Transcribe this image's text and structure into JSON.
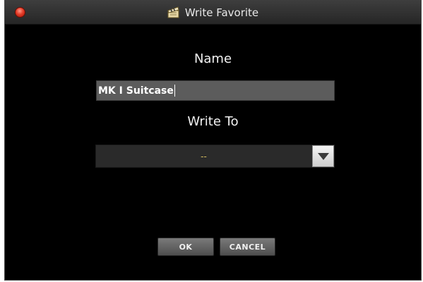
{
  "window": {
    "title": "Write Favorite",
    "title_icon": "clapperboard-icon",
    "close_icon": "close-icon",
    "accent_close": "#e43c28"
  },
  "form": {
    "name_label": "Name",
    "name_value": "MK I Suitcase",
    "write_to_label": "Write To",
    "write_to_value": "--",
    "dropdown_icon": "chevron-down-icon"
  },
  "buttons": {
    "ok_label": "OK",
    "cancel_label": "CANCEL"
  }
}
